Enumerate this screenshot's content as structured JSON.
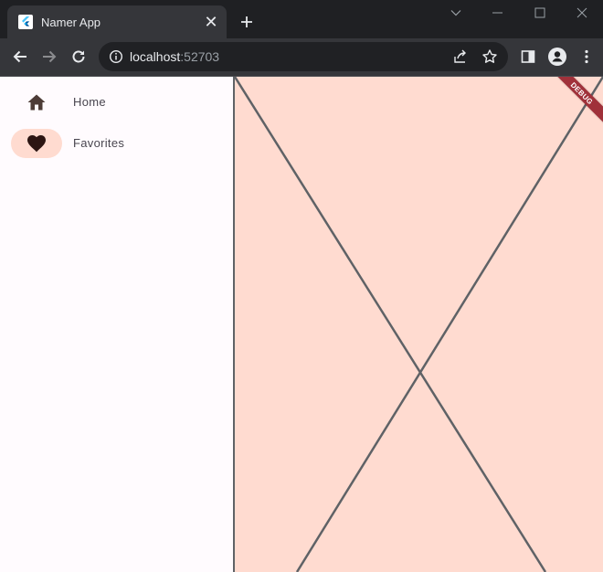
{
  "browser": {
    "tab": {
      "title": "Namer App",
      "favicon": "flutter-icon",
      "close_label": "✕"
    },
    "new_tab_icon": "plus-icon",
    "window_controls": [
      "chevron-down-icon",
      "minimize-icon",
      "maximize-icon",
      "close-icon"
    ],
    "address": {
      "host": "localhost",
      "port": ":52703"
    },
    "colors": {
      "tabstrip": "#1f2023",
      "toolbar": "#35363a",
      "omnibox": "#202124"
    }
  },
  "app": {
    "debug_label": "DEBUG",
    "nav": [
      {
        "label": "Home",
        "icon": "home-icon",
        "selected": false
      },
      {
        "label": "Favorites",
        "icon": "heart-icon",
        "selected": true
      }
    ],
    "colors": {
      "rail_background": "#fffbfe",
      "indicator": "#ffdbd0",
      "content_background": "#ffdbd0",
      "placeholder_lines": "#5f6266"
    }
  }
}
